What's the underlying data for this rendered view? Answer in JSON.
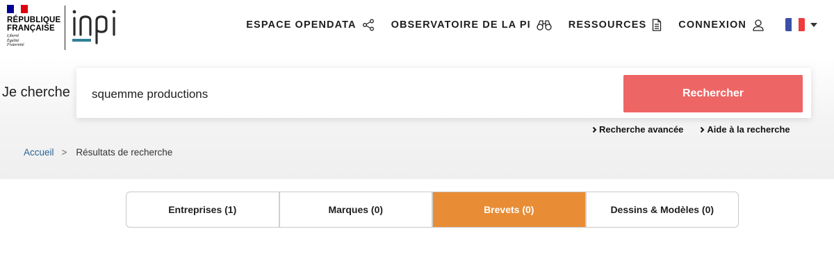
{
  "header": {
    "gov": {
      "name_line1": "RÉPUBLIQUE",
      "name_line2": "FRANÇAISE",
      "motto": [
        "Liberté",
        "Égalité",
        "Fraternité"
      ],
      "flag_colors": [
        "#000091",
        "#ffffff",
        "#e1000f"
      ]
    },
    "logo_text": "inpi",
    "brand_color": "#2f7f95",
    "nav": [
      {
        "label": "ESPACE OPENDATA",
        "icon": "share-nodes-icon"
      },
      {
        "label": "OBSERVATOIRE DE LA PI",
        "icon": "binoculars-icon"
      },
      {
        "label": "RESSOURCES",
        "icon": "document-icon"
      },
      {
        "label": "CONNEXION",
        "icon": "user-icon"
      }
    ],
    "language": {
      "flag": "french-flag-icon",
      "flag_colors": [
        "#3b4ea8",
        "#ffffff",
        "#ee3b3b"
      ]
    }
  },
  "search": {
    "label": "Je cherche",
    "query": "squemme productions",
    "button_label": "Rechercher",
    "button_color": "#ee6565",
    "links": [
      "Recherche avancée",
      "Aide à la recherche"
    ]
  },
  "breadcrumb": {
    "home": "Accueil",
    "separator": ">",
    "current": "Résultats de recherche"
  },
  "tabs": [
    {
      "label": "Entreprises (1)",
      "active": false
    },
    {
      "label": "Marques (0)",
      "active": false
    },
    {
      "label": "Brevets (0)",
      "active": true
    },
    {
      "label": "Dessins & Modèles (0)",
      "active": false
    }
  ],
  "active_tab_color": "#e88d36"
}
